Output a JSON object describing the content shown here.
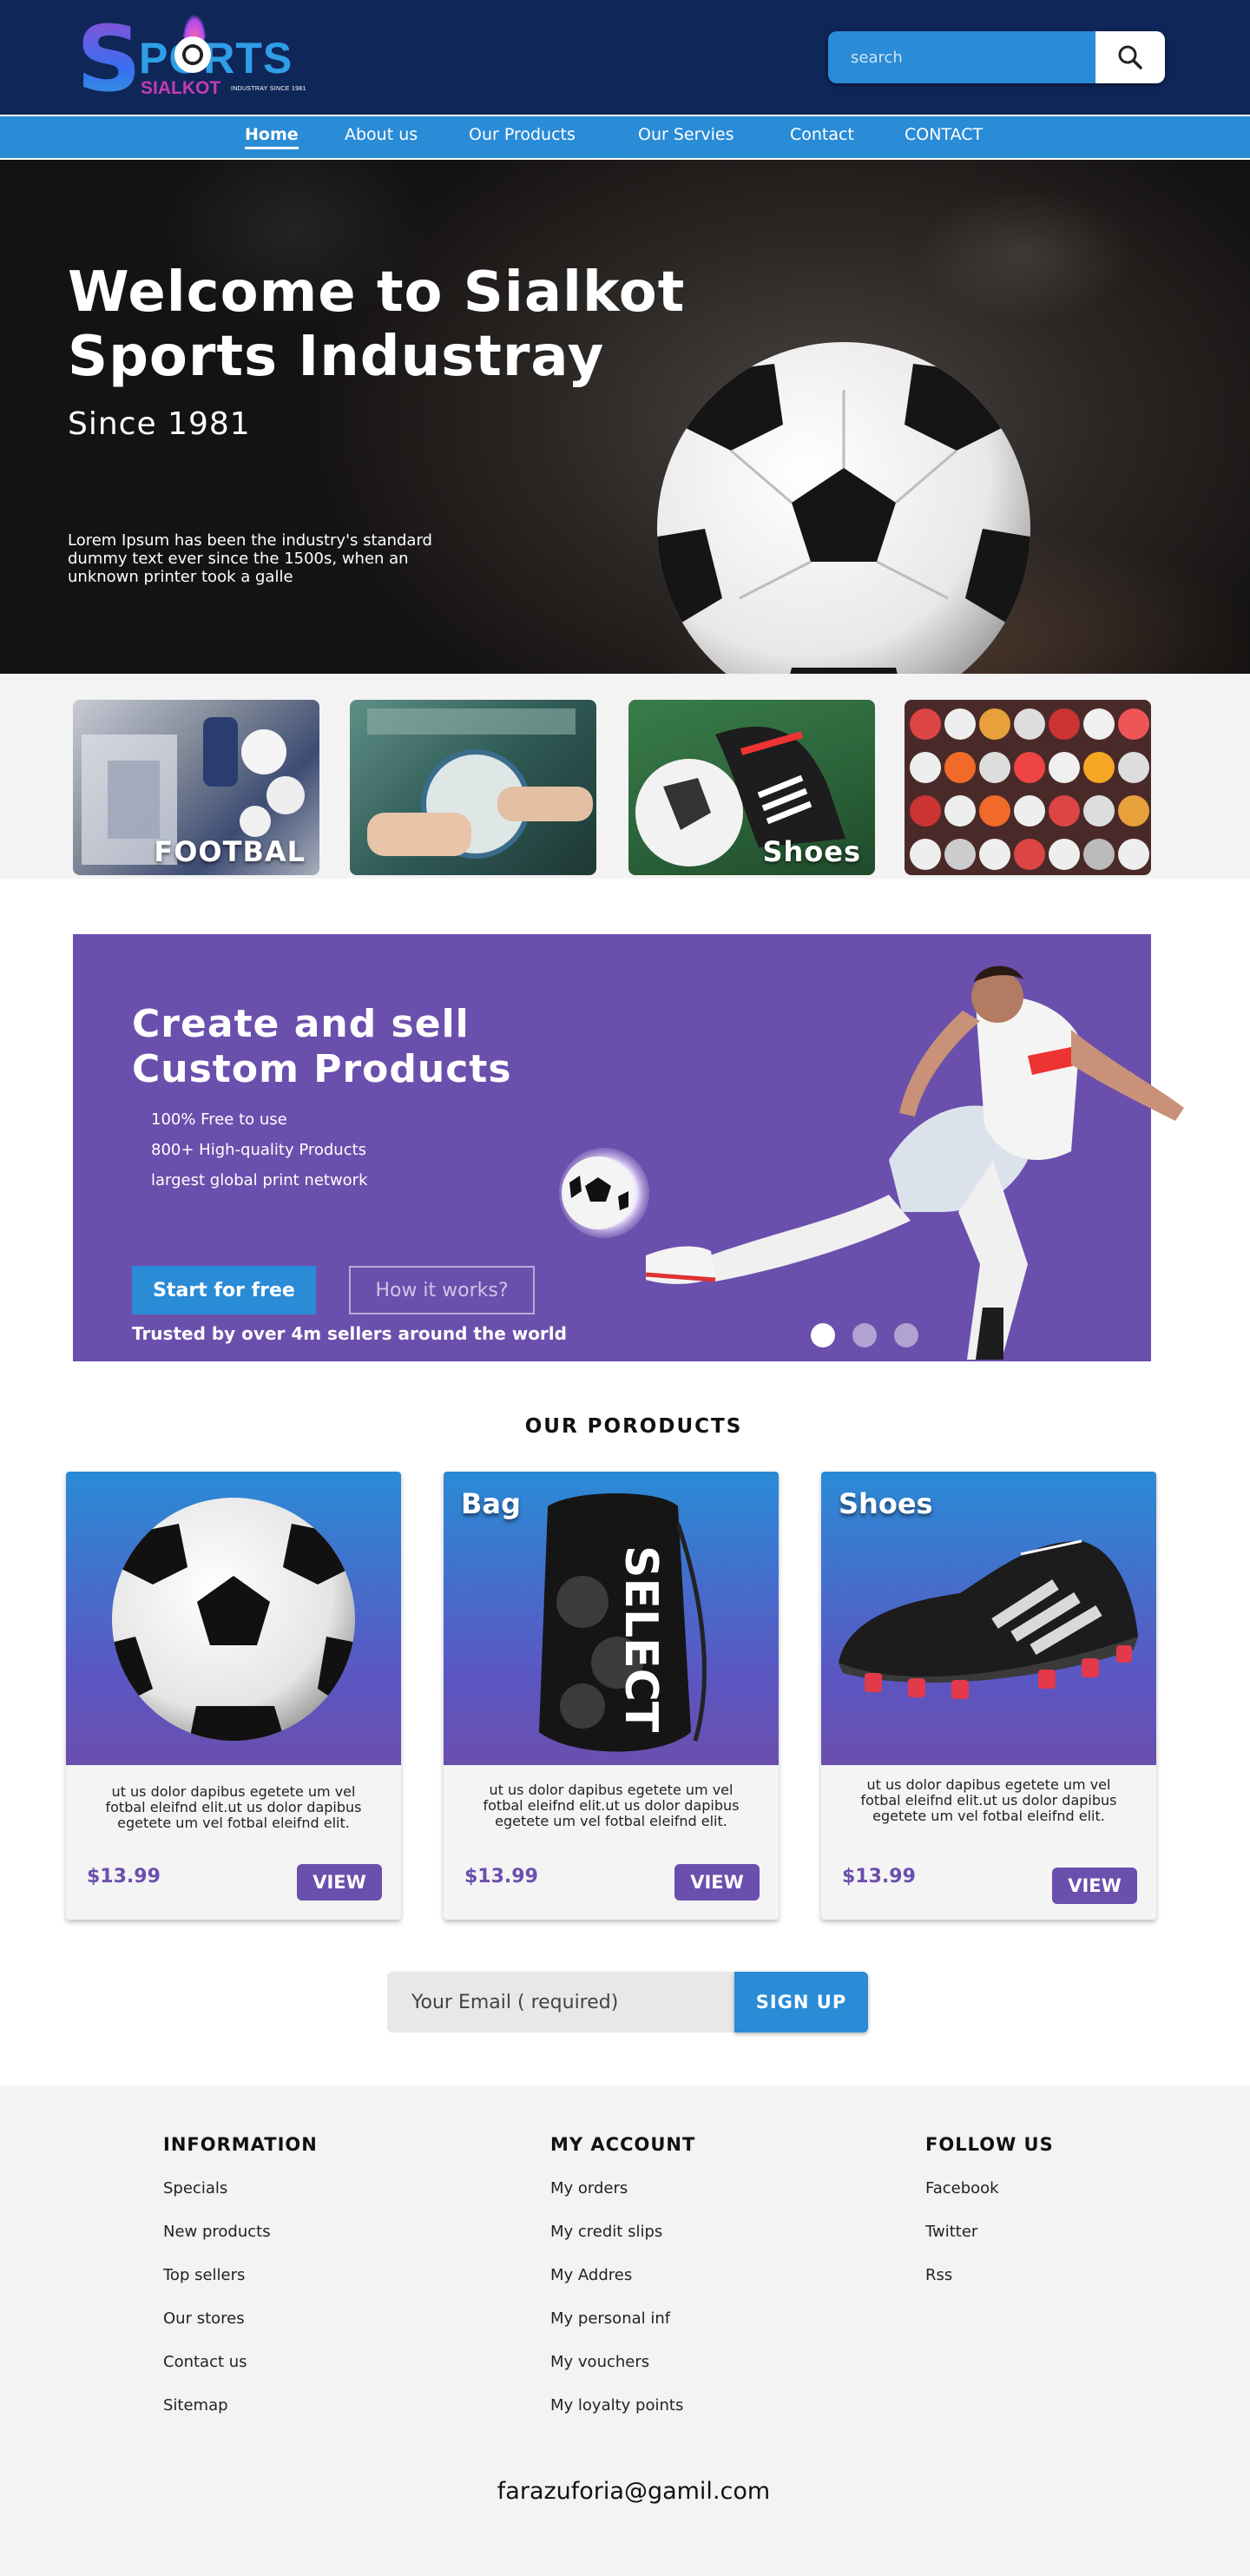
{
  "brand": {
    "logo_main": "PORTS",
    "logo_initial": "S",
    "logo_sub": "SIALKOT",
    "logo_tagline": "INDUSTRAY SINCE 1981"
  },
  "search": {
    "placeholder": "search",
    "icon": "search-icon"
  },
  "nav": {
    "items": [
      {
        "label": "Home",
        "active": true
      },
      {
        "label": "About us"
      },
      {
        "label": "Our Products"
      },
      {
        "label": "Our Servies"
      },
      {
        "label": "Contact"
      },
      {
        "label": "CONTACT"
      }
    ]
  },
  "hero": {
    "title": "Welcome to Sialkot Sports Industray",
    "subtitle": "Since 1981",
    "body": "Lorem Ipsum has been the industry's standard dummy text ever since the 1500s, when an unknown printer took a galle"
  },
  "categories": [
    {
      "label": "FOOTBAL"
    },
    {
      "label": ""
    },
    {
      "label": "Shoes"
    },
    {
      "label": ""
    }
  ],
  "promo": {
    "title_line1": "Create and sell",
    "title_line2": "Custom Products",
    "features": [
      "100% Free to use",
      "800+ High-quality Products",
      "largest global print network"
    ],
    "primary_button": "Start for free",
    "secondary_button": "How it works?",
    "trust": "Trusted by over 4m sellers around the world",
    "slides": 3,
    "active_slide": 1
  },
  "products": {
    "title": "OUR PORODUCTS",
    "items": [
      {
        "name": "",
        "desc": "ut us dolor dapibus egetete um vel fotbal  eleifnd elit.ut us dolor dapibus egetete um vel fotbal  eleifnd elit.",
        "price": "$13.99",
        "button": "VIEW"
      },
      {
        "name": "Bag",
        "desc": "ut us dolor dapibus egetete um vel fotbal  eleifnd elit.ut us dolor dapibus egetete um vel fotbal  eleifnd elit.",
        "price": "$13.99",
        "button": "VIEW"
      },
      {
        "name": "Shoes",
        "desc": "ut us dolor dapibus egetete um vel fotbal  eleifnd elit.ut us dolor dapibus egetete um vel fotbal  eleifnd elit.",
        "price": "$13.99",
        "button": "VIEW"
      }
    ]
  },
  "newsletter": {
    "placeholder": "Your Email ( required)",
    "button": "SIGN UP"
  },
  "footer": {
    "columns": [
      {
        "heading": "INFORMATION",
        "links": [
          "Specials",
          "New products",
          "Top sellers",
          "Our stores",
          "Contact us",
          "Sitemap"
        ]
      },
      {
        "heading": "MY ACCOUNT",
        "links": [
          "My orders",
          "My credit slips",
          "My Addres",
          "My personal inf",
          "My vouchers",
          "My loyalty  points"
        ]
      },
      {
        "heading": "FOLLOW US",
        "links": [
          "Facebook",
          "Twitter",
          "Rss"
        ]
      }
    ],
    "email": "farazuforia@gamil.com"
  },
  "colors": {
    "header_bg": "#0f2659",
    "accent_blue": "#2a8bd6",
    "accent_purple": "#6b4fad",
    "footer_bg": "#f3f3f3"
  }
}
